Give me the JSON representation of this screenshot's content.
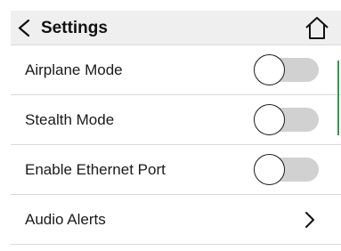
{
  "header": {
    "title": "Settings",
    "back_icon": "chevron-left-icon",
    "home_icon": "home-icon"
  },
  "settings": [
    {
      "label": "Airplane Mode",
      "control": "toggle",
      "on": false
    },
    {
      "label": "Stealth Mode",
      "control": "toggle",
      "on": false
    },
    {
      "label": "Enable Ethernet Port",
      "control": "toggle",
      "on": false
    },
    {
      "label": "Audio Alerts",
      "control": "chevron-right-icon"
    }
  ],
  "colors": {
    "header_background": "#efefef",
    "toggle_off_track": "#d1d1d1",
    "scroll_indicator": "#2e9e3e",
    "divider": "#d9d9d9"
  }
}
